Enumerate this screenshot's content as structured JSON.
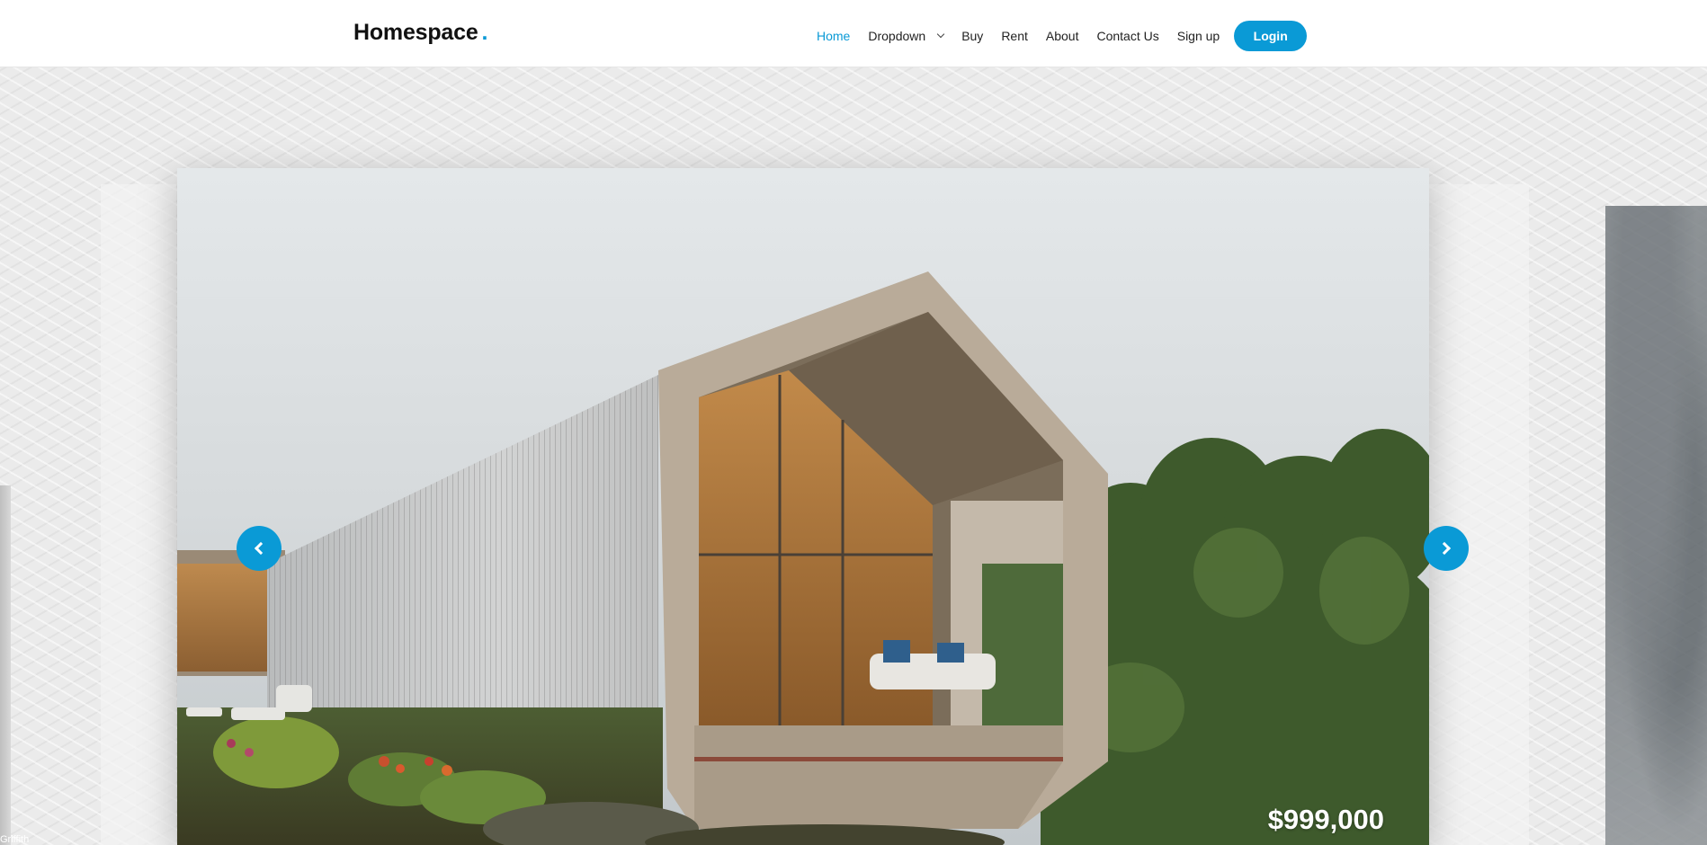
{
  "brand": {
    "name": "Homespace",
    "dot": "."
  },
  "nav": {
    "items": [
      {
        "label": "Home",
        "active": true
      },
      {
        "label": "Dropdown",
        "has_dropdown": true
      },
      {
        "label": "Buy"
      },
      {
        "label": "Rent"
      },
      {
        "label": "About"
      },
      {
        "label": "Contact Us"
      },
      {
        "label": "Sign up"
      }
    ],
    "login_label": "Login"
  },
  "carousel": {
    "current_slide": {
      "price": "$999,000",
      "image": "modern-corrugated-metal-house"
    },
    "side_left_caption": "Griffith"
  },
  "colors": {
    "accent": "#0a9ad6",
    "text": "#222222",
    "navbar_bg": "#ffffff"
  }
}
